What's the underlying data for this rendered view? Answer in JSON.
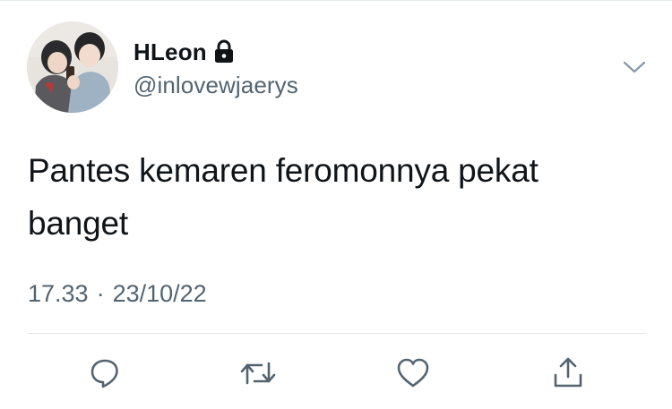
{
  "tweet": {
    "author": {
      "display_name": "HLeon",
      "handle": "@inlovewjaerys",
      "protected_icon": "lock-icon"
    },
    "text": "Pantes kemaren feromonnya pekat banget",
    "time": "17.33",
    "separator": "·",
    "date": "23/10/22"
  },
  "icons": {
    "menu": "chevron-down-icon",
    "reply": "reply-icon",
    "retweet": "retweet-icon",
    "like": "heart-icon",
    "share": "share-icon"
  },
  "colors": {
    "text_primary": "#0f1419",
    "text_secondary": "#536471",
    "divider": "#e1e6ea",
    "icon": "#536471"
  }
}
